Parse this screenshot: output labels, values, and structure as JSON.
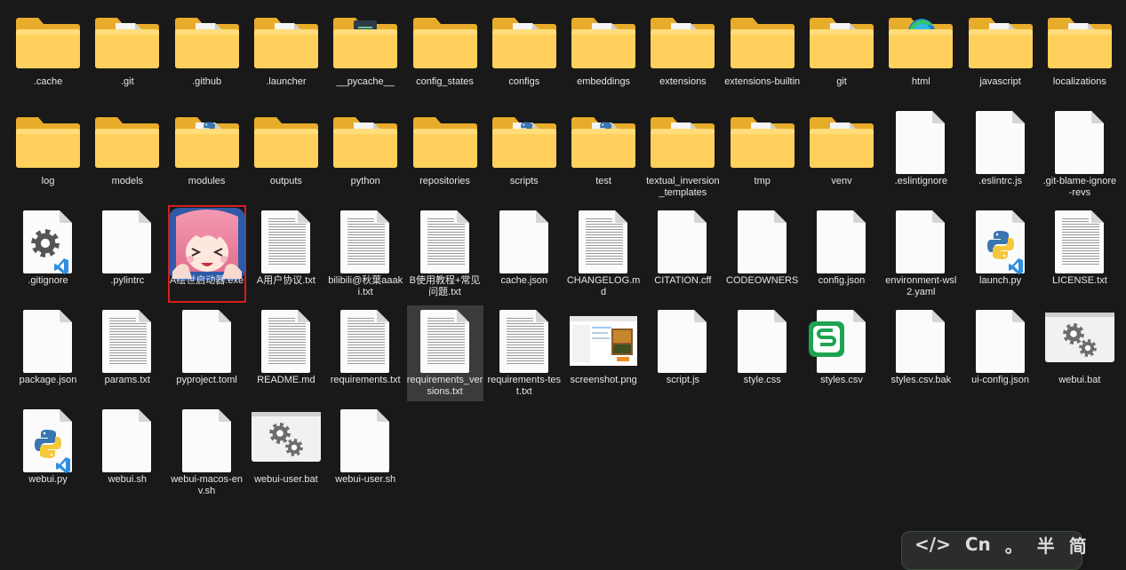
{
  "items": [
    {
      "name": ".cache",
      "type": "folder"
    },
    {
      "name": ".git",
      "type": "folder-doc"
    },
    {
      "name": ".github",
      "type": "folder-doc"
    },
    {
      "name": ".launcher",
      "type": "folder-doc"
    },
    {
      "name": "__pycache__",
      "type": "folder-dark"
    },
    {
      "name": "config_states",
      "type": "folder"
    },
    {
      "name": "configs",
      "type": "folder-doc"
    },
    {
      "name": "embeddings",
      "type": "folder-doc"
    },
    {
      "name": "extensions",
      "type": "folder-doc"
    },
    {
      "name": "extensions-builtin",
      "type": "folder"
    },
    {
      "name": "git",
      "type": "folder-doc"
    },
    {
      "name": "html",
      "type": "folder-edge"
    },
    {
      "name": "javascript",
      "type": "folder-doc"
    },
    {
      "name": "localizations",
      "type": "folder-doc"
    },
    {
      "name": "log",
      "type": "folder"
    },
    {
      "name": "models",
      "type": "folder"
    },
    {
      "name": "modules",
      "type": "folder-python"
    },
    {
      "name": "outputs",
      "type": "folder"
    },
    {
      "name": "python",
      "type": "folder-doc"
    },
    {
      "name": "repositories",
      "type": "folder"
    },
    {
      "name": "scripts",
      "type": "folder-python"
    },
    {
      "name": "test",
      "type": "folder-python"
    },
    {
      "name": "textual_inversion_templates",
      "type": "folder-doc"
    },
    {
      "name": "tmp",
      "type": "folder-doc"
    },
    {
      "name": "venv",
      "type": "folder-doc"
    },
    {
      "name": ".eslintignore",
      "type": "file"
    },
    {
      "name": ".eslintrc.js",
      "type": "file"
    },
    {
      "name": ".git-blame-ignore-revs",
      "type": "file"
    },
    {
      "name": ".gitignore",
      "type": "file-gear-vscode"
    },
    {
      "name": ".pylintrc",
      "type": "file"
    },
    {
      "name": "A绘世启动器.exe",
      "type": "app-anime",
      "boxed": true
    },
    {
      "name": "A用户协议.txt",
      "type": "file-text"
    },
    {
      "name": "bilibili@秋葉aaaki.txt",
      "type": "file-text"
    },
    {
      "name": "B使用教程+常见问题.txt",
      "type": "file-text"
    },
    {
      "name": "cache.json",
      "type": "file"
    },
    {
      "name": "CHANGELOG.md",
      "type": "file-text"
    },
    {
      "name": "CITATION.cff",
      "type": "file"
    },
    {
      "name": "CODEOWNERS",
      "type": "file"
    },
    {
      "name": "config.json",
      "type": "file"
    },
    {
      "name": "environment-wsl2.yaml",
      "type": "file"
    },
    {
      "name": "launch.py",
      "type": "file-python"
    },
    {
      "name": "LICENSE.txt",
      "type": "file-text"
    },
    {
      "name": "package.json",
      "type": "file"
    },
    {
      "name": "params.txt",
      "type": "file-text"
    },
    {
      "name": "pyproject.toml",
      "type": "file"
    },
    {
      "name": "README.md",
      "type": "file-text"
    },
    {
      "name": "requirements.txt",
      "type": "file-text"
    },
    {
      "name": "requirements_versions.txt",
      "type": "file-text",
      "selected": true
    },
    {
      "name": "requirements-test.txt",
      "type": "file-text"
    },
    {
      "name": "screenshot.png",
      "type": "image-thumb"
    },
    {
      "name": "script.js",
      "type": "file"
    },
    {
      "name": "style.css",
      "type": "file"
    },
    {
      "name": "styles.csv",
      "type": "file-sheet"
    },
    {
      "name": "styles.csv.bak",
      "type": "file"
    },
    {
      "name": "ui-config.json",
      "type": "file"
    },
    {
      "name": "webui.bat",
      "type": "bat"
    },
    {
      "name": "webui.py",
      "type": "file-python"
    },
    {
      "name": "webui.sh",
      "type": "file"
    },
    {
      "name": "webui-macos-env.sh",
      "type": "file"
    },
    {
      "name": "webui-user.bat",
      "type": "bat"
    },
    {
      "name": "webui-user.sh",
      "type": "file"
    }
  ],
  "ime": {
    "code_symbol": "</>",
    "lang": "Cn",
    "punct": "。",
    "mode": "半",
    "script": "简"
  },
  "colors": {
    "background": "#191919",
    "folder": "#f6c64a",
    "selection": "#3b3b3b",
    "highlight_box": "#d71e1e"
  }
}
